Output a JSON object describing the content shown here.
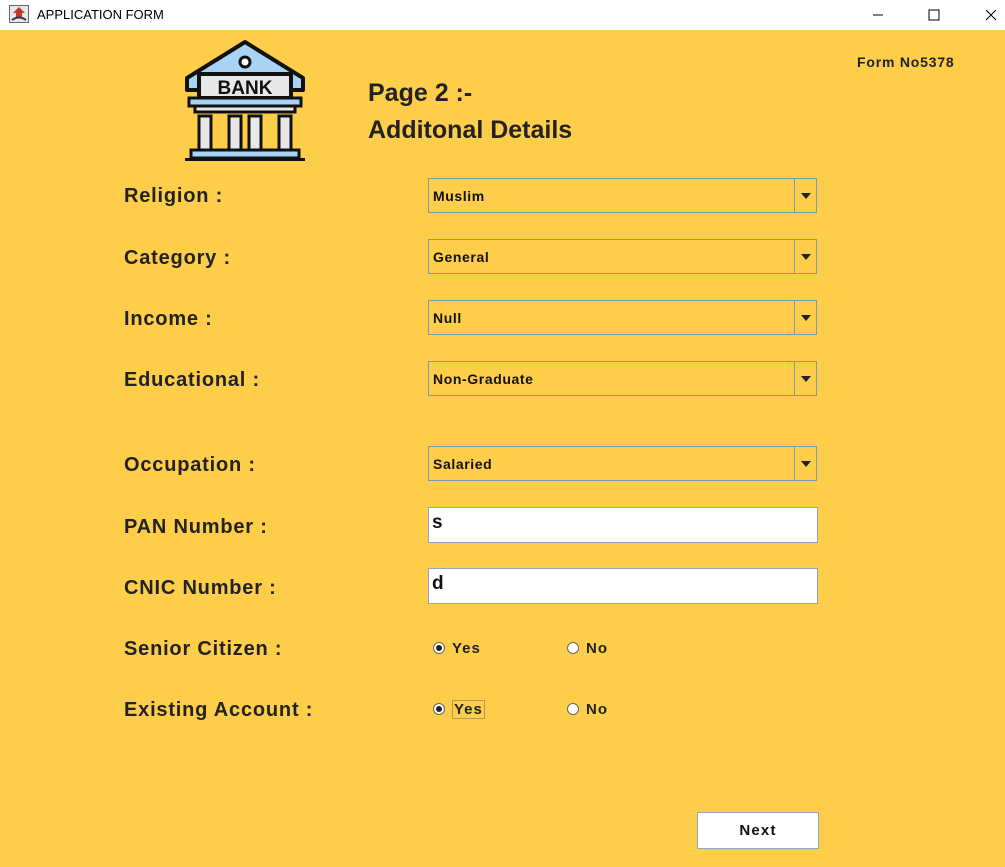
{
  "window": {
    "title": "APPLICATION FORM",
    "icon": "java-app-icon"
  },
  "header": {
    "logo_text": "BANK",
    "page_label": "Page 2 :-",
    "section_title": "Additonal Details",
    "form_no": "Form No5378"
  },
  "fields": {
    "religion": {
      "label": "Religion :",
      "value": "Muslim"
    },
    "category": {
      "label": "Category :",
      "value": "General"
    },
    "income": {
      "label": "Income :",
      "value": "Null"
    },
    "educational": {
      "label": "Educational :",
      "value": "Non-Graduate"
    },
    "occupation": {
      "label": "Occupation :",
      "value": "Salaried"
    },
    "pan": {
      "label": "PAN Number :",
      "value": "s"
    },
    "cnic": {
      "label": "CNIC Number :",
      "value": "d"
    },
    "senior_citizen": {
      "label": "Senior Citizen :",
      "yes": "Yes",
      "no": "No",
      "selected": "Yes"
    },
    "existing_account": {
      "label": "Existing Account :",
      "yes": "Yes",
      "no": "No",
      "selected": "Yes"
    }
  },
  "buttons": {
    "next": "Next"
  },
  "colors": {
    "background": "#FECD4A",
    "field_border": "#7a9ab8",
    "text": "#222222"
  }
}
